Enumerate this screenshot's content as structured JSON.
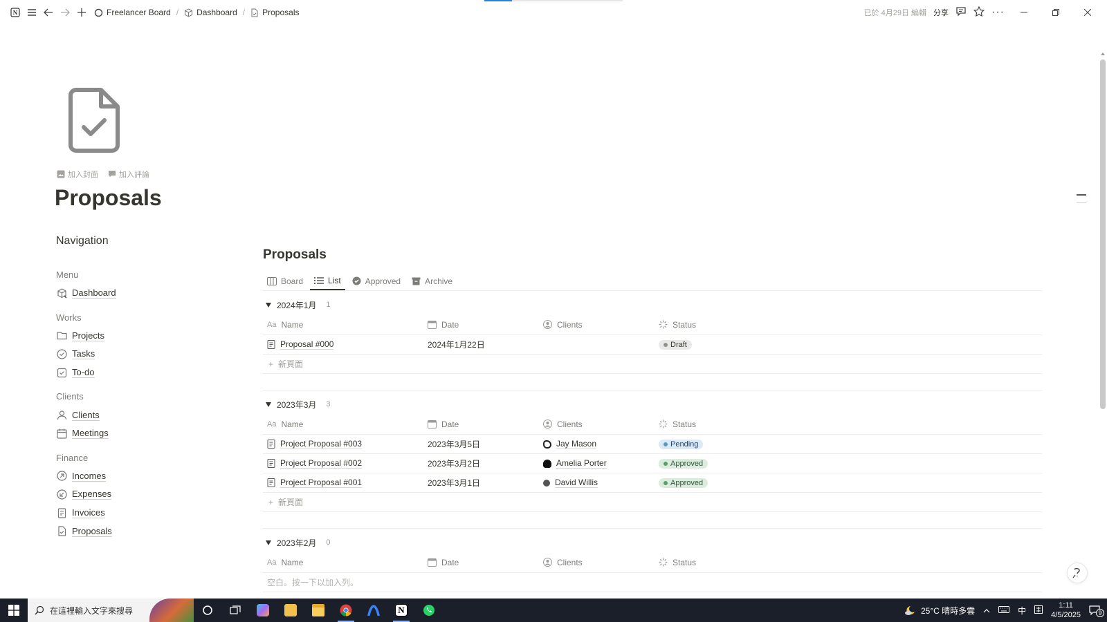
{
  "topbar": {
    "breadcrumbs": [
      "Freelancer Board",
      "Dashboard",
      "Proposals"
    ],
    "edited": "已於 4月29日 編輯",
    "share": "分享"
  },
  "page": {
    "title": "Proposals",
    "add_cover": "加入封面",
    "add_comment": "加入評論"
  },
  "nav": {
    "title": "Navigation",
    "sections": [
      {
        "name": "Menu",
        "items": [
          "Dashboard"
        ]
      },
      {
        "name": "Works",
        "items": [
          "Projects",
          "Tasks",
          "To-do"
        ]
      },
      {
        "name": "Clients",
        "items": [
          "Clients",
          "Meetings"
        ]
      },
      {
        "name": "Finance",
        "items": [
          "Incomes",
          "Expenses",
          "Invoices",
          "Proposals"
        ]
      }
    ]
  },
  "db": {
    "title": "Proposals",
    "tabs": [
      "Board",
      "List",
      "Approved",
      "Archive"
    ],
    "columns": {
      "name": "Name",
      "date": "Date",
      "clients": "Clients",
      "status": "Status"
    },
    "new_page": "新頁面",
    "empty_hint": "空白。按一下以加入列。",
    "groups": [
      {
        "label": "2024年1月",
        "count": "1",
        "rows": [
          {
            "name": "Proposal #000",
            "date": "2024年1月22日",
            "client": "",
            "status": "Draft"
          }
        ]
      },
      {
        "label": "2023年3月",
        "count": "3",
        "rows": [
          {
            "name": "Project Proposal #003",
            "date": "2023年3月5日",
            "client": "Jay Mason",
            "status": "Pending"
          },
          {
            "name": "Project Proposal #002",
            "date": "2023年3月2日",
            "client": "Amelia Porter",
            "status": "Approved"
          },
          {
            "name": "Project Proposal #001",
            "date": "2023年3月1日",
            "client": "David Willis",
            "status": "Approved"
          }
        ]
      },
      {
        "label": "2023年2月",
        "count": "0",
        "rows": []
      }
    ]
  },
  "status_colors": {
    "Draft": {
      "bg": "#e9e9e7",
      "dot": "#91918e",
      "fg": "#37352f"
    },
    "Pending": {
      "bg": "#dbeaf7",
      "dot": "#5b97bd",
      "fg": "#28456c"
    },
    "Approved": {
      "bg": "#dcecdc",
      "dot": "#5c9e6a",
      "fg": "#2b593f"
    }
  },
  "taskbar": {
    "search_placeholder": "在這裡輸入文字來搜尋",
    "weather": "25°C  晴時多雲",
    "ime": "中",
    "time": "1:11",
    "date": "4/5/2025",
    "notif_count": "9"
  }
}
